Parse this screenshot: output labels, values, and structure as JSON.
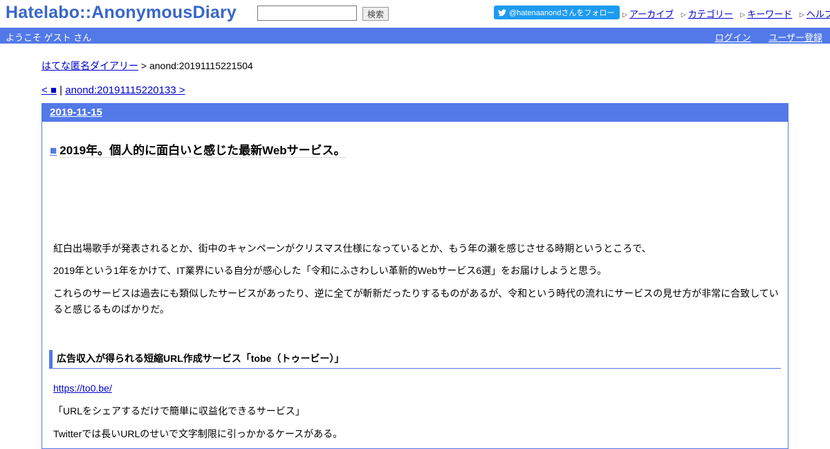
{
  "header": {
    "logo": "Hatelabo::AnonymousDiary",
    "search": {
      "value": "",
      "button_label": "検索"
    },
    "twitter_follow": "@hatenaanondさんをフォロー",
    "nav": [
      "アーカイブ",
      "カテゴリー",
      "キーワード",
      "ヘルプ"
    ]
  },
  "welcome_bar": {
    "greeting": "ようこそ ゲスト さん",
    "login": "ログイン",
    "register": "ユーザー登録"
  },
  "breadcrumb": {
    "home": "はてな匿名ダイアリー",
    "separator": " > ",
    "current": "anond:20191115221504"
  },
  "pager": {
    "prev": "< ■",
    "separator": " | ",
    "next": "anond:20191115220133 >"
  },
  "day": {
    "date": "2019-11-15",
    "title_mark": "■",
    "title": "2019年。個人的に面白いと感じた最新Webサービス。",
    "paragraphs": [
      "紅白出場歌手が発表されるとか、街中のキャンペーンがクリスマス仕様になっているとか、もう年の瀬を感じさせる時期というところで、",
      "2019年という1年をかけて、IT業界にいる自分が感心した「令和にふさわしい革新的Webサービス6選」をお届けしようと思う。",
      "これらのサービスは過去にも類似したサービスがあったり、逆に全てが斬新だったりするものがあるが、令和という時代の流れにサービスの見せ方が非常に合致していると感じるものばかりだ。"
    ],
    "section_heading": "広告収入が得られる短縮URL作成サービス「tobe（トゥービー）」",
    "link": "https://to0.be/",
    "quote": "「URLをシェアするだけで簡単に収益化できるサービス」",
    "last_line": "Twitterでは長いURLのせいで文字制限に引っかかるケースがある。"
  }
}
